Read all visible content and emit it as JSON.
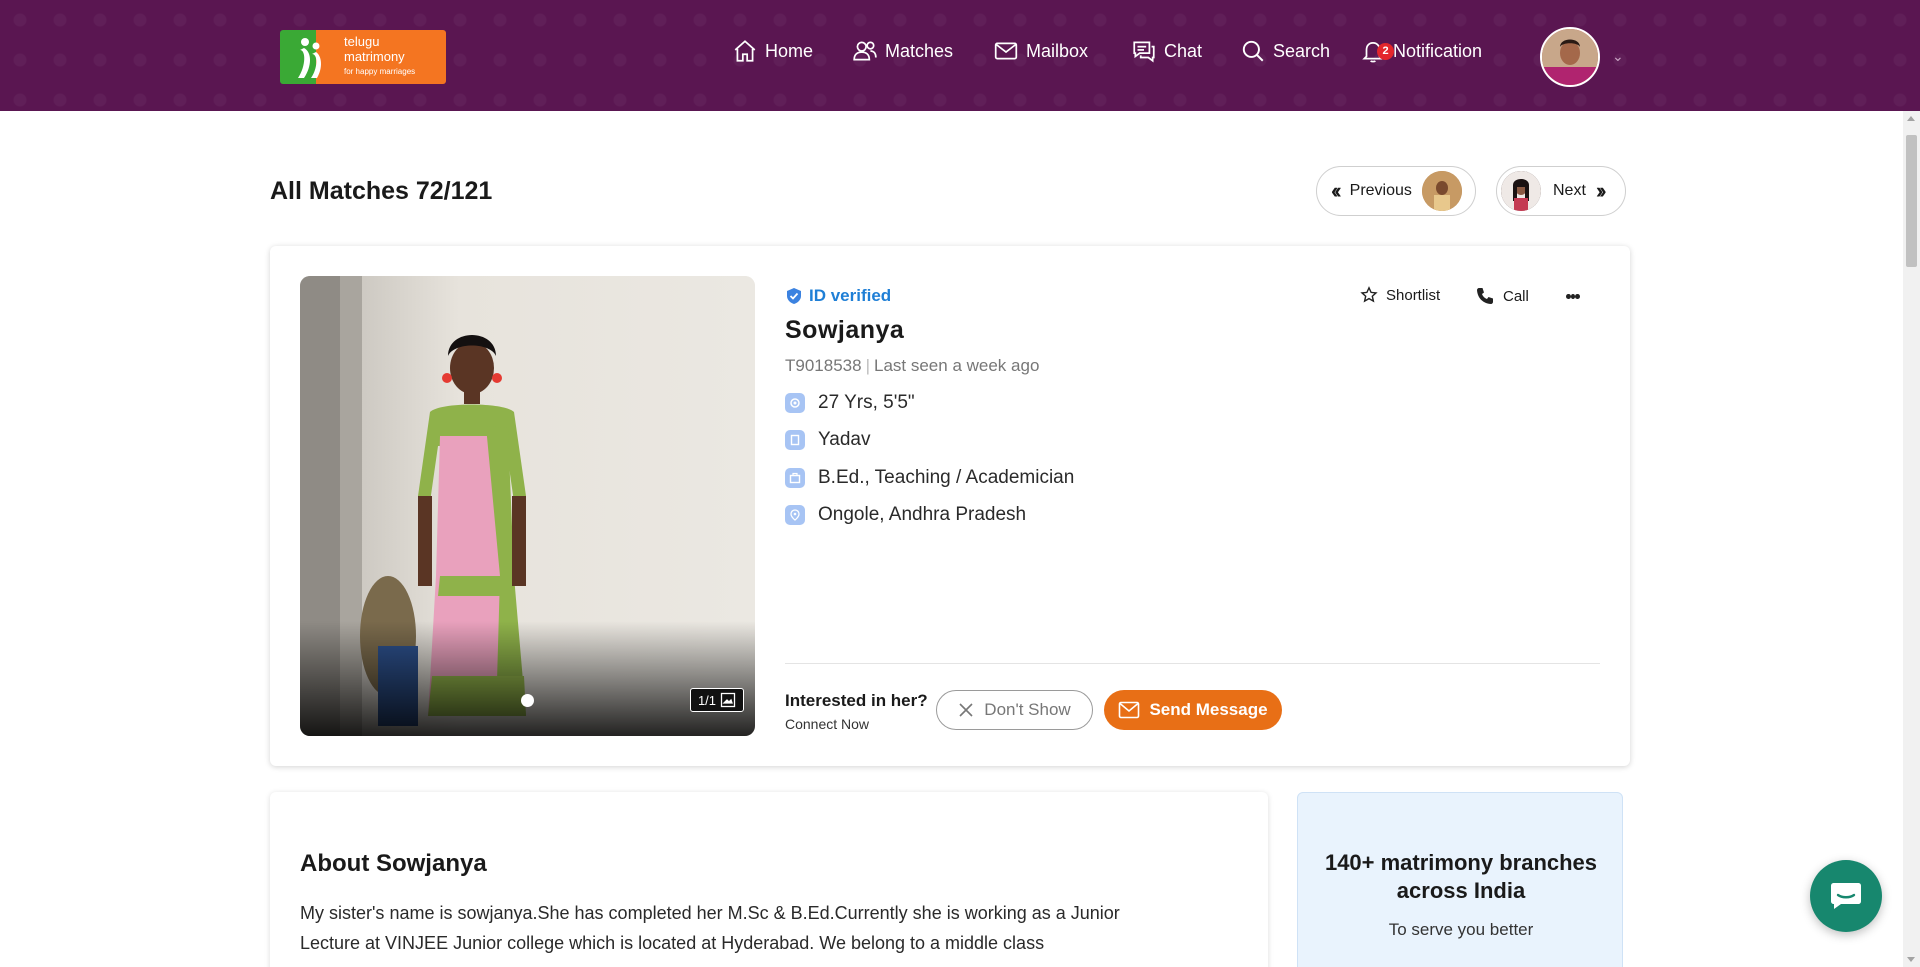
{
  "brand": {
    "logo_line1": "telugu",
    "logo_line2": "matrimony",
    "logo_tagline": "for happy marriages",
    "colors": {
      "header": "#5a1651",
      "accent": "#e86f16",
      "verified": "#1f7fd6",
      "logo_green": "#3aa935",
      "logo_orange": "#f47521"
    }
  },
  "nav": {
    "home": "Home",
    "matches": "Matches",
    "mailbox": "Mailbox",
    "chat": "Chat",
    "search": "Search",
    "notification": "Notification",
    "notification_count": "2"
  },
  "page": {
    "title": "All Matches 72/121",
    "previous": "Previous",
    "next": "Next"
  },
  "profile": {
    "id_verified": "ID verified",
    "name": "Sowjanya",
    "profile_id": "T9018538",
    "last_seen": "Last seen a week ago",
    "age_height": "27 Yrs, 5'5\"",
    "caste": "Yadav",
    "education_profession": "B.Ed., Teaching / Academician",
    "location": "Ongole, Andhra Pradesh",
    "photo_counter": "1/1",
    "shortlist": "Shortlist",
    "call": "Call",
    "interest_question": "Interested in her?",
    "connect_now": "Connect Now",
    "dont_show": "Don't Show",
    "send_message": "Send Message"
  },
  "about": {
    "heading": "About Sowjanya",
    "text": "My sister's name is sowjanya.She has completed her M.Sc & B.Ed.Currently she is working as a Junior Lecture at VINJEE Junior college which is located at Hyderabad. We belong to a middle class"
  },
  "branches": {
    "heading": "140+ matrimony branches across India",
    "subtext": "To serve you better"
  }
}
